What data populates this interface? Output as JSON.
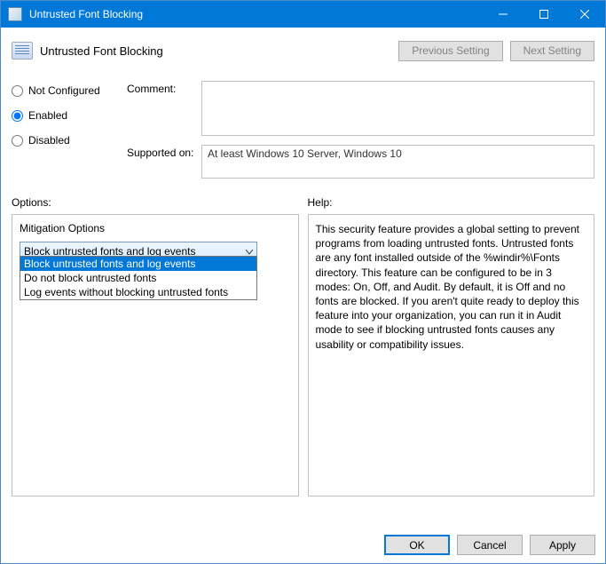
{
  "window": {
    "title": "Untrusted Font Blocking"
  },
  "header": {
    "title": "Untrusted Font Blocking",
    "prev": "Previous Setting",
    "next": "Next Setting"
  },
  "radios": {
    "not_configured": "Not Configured",
    "enabled": "Enabled",
    "disabled": "Disabled"
  },
  "fields": {
    "comment_label": "Comment:",
    "comment_value": "",
    "supported_label": "Supported on:",
    "supported_value": "At least Windows 10 Server, Windows 10"
  },
  "options": {
    "label": "Options:",
    "mitigation_label": "Mitigation Options",
    "combo_value": "Block untrusted fonts and log events",
    "dropdown": [
      "Block untrusted fonts and log events",
      "Do not block untrusted fonts",
      "Log events without blocking untrusted fonts"
    ]
  },
  "help": {
    "label": "Help:",
    "text": "This security feature provides a global setting to prevent programs from loading untrusted fonts. Untrusted fonts are any font installed outside of the %windir%\\Fonts directory. This feature can be configured to be in 3 modes: On, Off, and Audit. By default, it is Off and no fonts are blocked. If you aren't quite ready to deploy this feature into your organization, you can run it in Audit mode to see if blocking untrusted fonts causes any usability or compatibility issues."
  },
  "buttons": {
    "ok": "OK",
    "cancel": "Cancel",
    "apply": "Apply"
  }
}
